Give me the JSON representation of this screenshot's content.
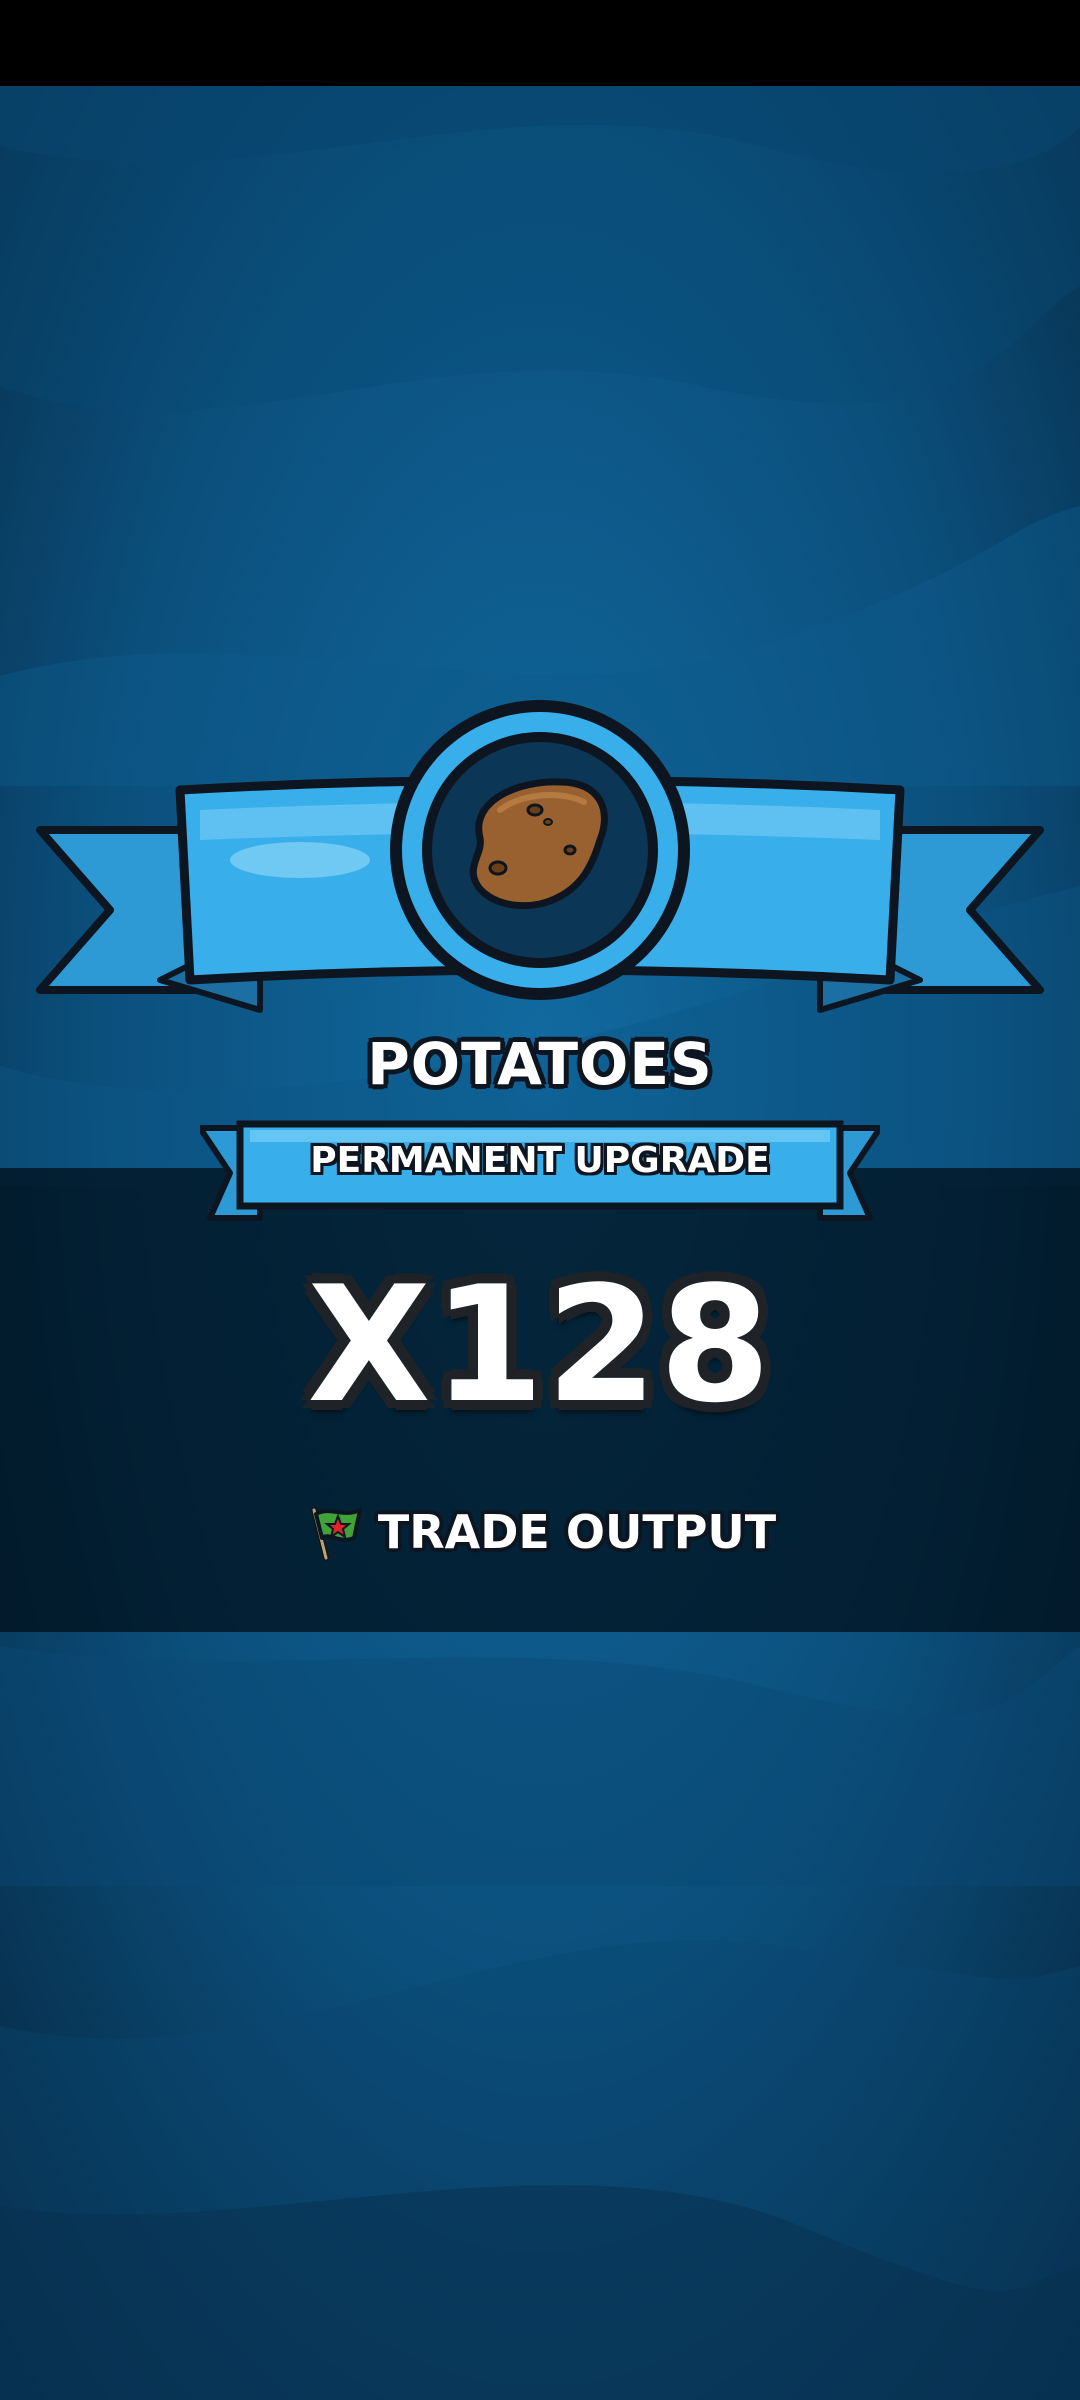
{
  "reward": {
    "item_name": "POTATOES",
    "item_icon": "potato-icon",
    "upgrade_type": "PERMANENT UPGRADE",
    "multiplier": "X128",
    "bonus_label": "TRADE OUTPUT",
    "bonus_icon": "flag-icon"
  },
  "colors": {
    "background_dark": "#0a3a5c",
    "background_light": "#0f5f8f",
    "ribbon_blue": "#34a9e6",
    "ribbon_outline": "#0d1620",
    "potato_brown": "#9a6130",
    "flag_green": "#3fa33a",
    "flag_star": "#e2242b"
  }
}
